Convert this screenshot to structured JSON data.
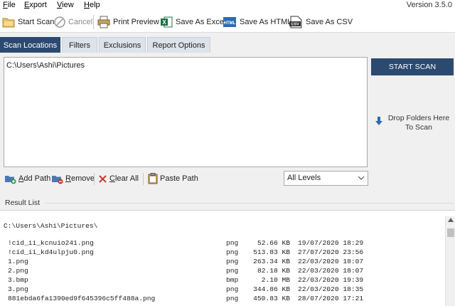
{
  "menu": {
    "items": [
      "File",
      "Export",
      "View",
      "Help"
    ],
    "version": "Version 3.5.0"
  },
  "toolbar": {
    "start_scan": "Start Scan",
    "cancel": "Cancel",
    "print_preview": "Print Preview",
    "save_excel": "Save As Excel",
    "save_html": "Save As HTML",
    "save_csv": "Save As CSV"
  },
  "tabs": [
    "Scan Locations",
    "Filters",
    "Exclusions",
    "Report Options"
  ],
  "scan": {
    "path": "C:\\Users\\Ashi\\Pictures",
    "start_button": "START SCAN",
    "drop_hint": "Drop Folders Here To Scan"
  },
  "path_actions": {
    "add": "Add Path",
    "remove": "Remove",
    "clear": "Clear All",
    "paste": "Paste Path",
    "levels": "All Levels"
  },
  "results": {
    "label": "Result List",
    "root": "C:\\Users\\Ashi\\Pictures\\",
    "rows": [
      {
        "name": "!cid_ii_kcnuio241.png",
        "type": "png",
        "size": "52.66 KB",
        "date": "19/07/2020 18:29"
      },
      {
        "name": "!cid_ii_kd4ulpju0.png",
        "type": "png",
        "size": "513.83 KB",
        "date": "27/07/2020 23:56"
      },
      {
        "name": "1.png",
        "type": "png",
        "size": "263.34 KB",
        "date": "22/03/2020 18:07"
      },
      {
        "name": "2.png",
        "type": "png",
        "size": "82.18 KB",
        "date": "22/03/2020 18:07"
      },
      {
        "name": "3.bmp",
        "type": "bmp",
        "size": "2.10 MB",
        "date": "22/03/2020 19:39"
      },
      {
        "name": "3.png",
        "type": "png",
        "size": "344.86 KB",
        "date": "22/03/2020 18:35"
      },
      {
        "name": "881ebda6fa1390ed9f645396c5ff488a.png",
        "type": "png",
        "size": "450.83 KB",
        "date": "28/07/2020 17:21"
      }
    ]
  },
  "icons": {
    "start_scan": "scan-folder-icon",
    "cancel": "cancel-circle-icon",
    "print_preview": "printer-icon",
    "save_excel": "excel-icon",
    "save_html": "html-file-icon",
    "save_csv": "csv-file-icon",
    "add": "add-folder-icon",
    "remove": "remove-folder-icon",
    "clear": "clear-x-icon",
    "paste": "clipboard-icon",
    "drop": "down-arrow-icon"
  },
  "colors": {
    "accent": "#2c4a70",
    "excel": "#1e7145",
    "html": "#2b6cb0",
    "clear": "#c0392b"
  }
}
